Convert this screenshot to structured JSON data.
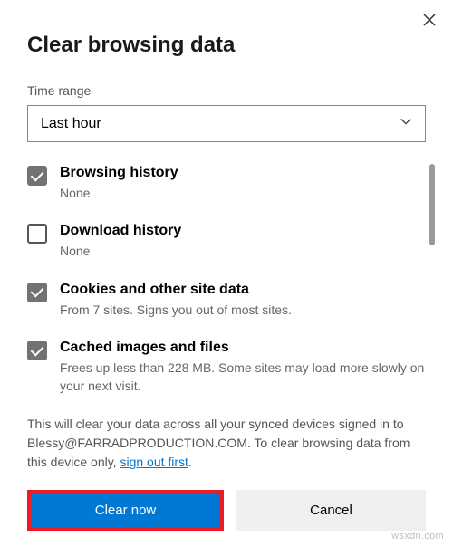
{
  "dialog": {
    "title": "Clear browsing data",
    "time_range_label": "Time range",
    "time_range_value": "Last hour"
  },
  "options": [
    {
      "id": "browsing-history",
      "checked": true,
      "title": "Browsing history",
      "desc": "None"
    },
    {
      "id": "download-history",
      "checked": false,
      "title": "Download history",
      "desc": "None"
    },
    {
      "id": "cookies",
      "checked": true,
      "title": "Cookies and other site data",
      "desc": "From 7 sites. Signs you out of most sites."
    },
    {
      "id": "cached",
      "checked": true,
      "title": "Cached images and files",
      "desc": "Frees up less than 228 MB. Some sites may load more slowly on your next visit."
    }
  ],
  "footer": {
    "note_pre": "This will clear your data across all your synced devices signed in to Blessy@FARRADPRODUCTION.COM. To clear browsing data from this device only, ",
    "link_text": "sign out first",
    "note_post": "."
  },
  "buttons": {
    "primary": "Clear now",
    "secondary": "Cancel"
  },
  "watermark": "wsxdn.com"
}
